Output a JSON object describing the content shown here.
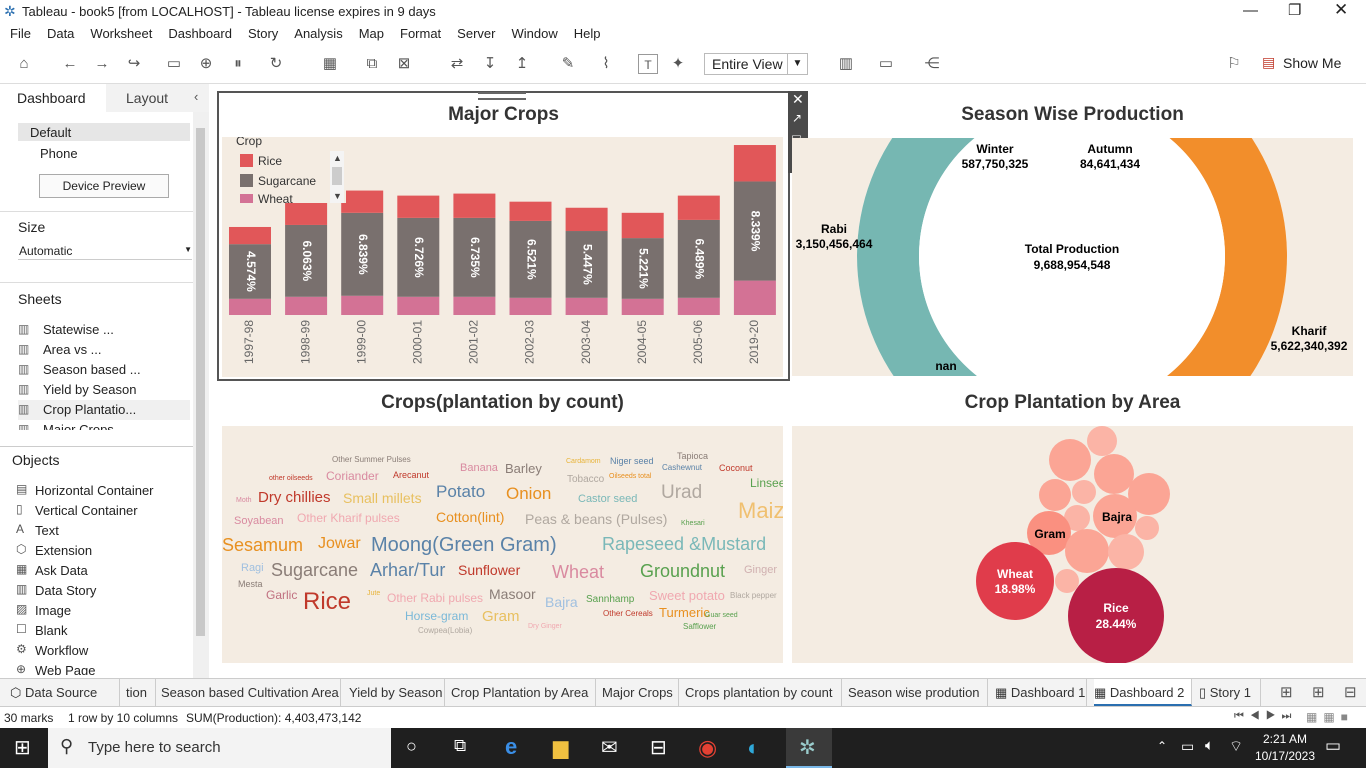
{
  "window": {
    "title": "Tableau - book5 [from LOCALHOST] - Tableau license expires in 9 days"
  },
  "menu": [
    "File",
    "Data",
    "Worksheet",
    "Dashboard",
    "Story",
    "Analysis",
    "Map",
    "Format",
    "Server",
    "Window",
    "Help"
  ],
  "toolbar": {
    "view_select": "Entire View",
    "show_me": "Show Me"
  },
  "left": {
    "tab_dashboard": "Dashboard",
    "tab_layout": "Layout",
    "device_default": "Default",
    "device_phone": "Phone",
    "device_preview": "Device Preview",
    "size_label": "Size",
    "size_value": "Automatic",
    "sheets_label": "Sheets",
    "sheets": [
      "Statewise ...",
      "Area vs ...",
      "Season based ...",
      "Yield by Season",
      "Crop Plantatio...",
      "Major Crops"
    ],
    "objects_label": "Objects",
    "objects": [
      "Horizontal Container",
      "Vertical Container",
      "Text",
      "Extension",
      "Ask Data",
      "Data Story",
      "Image",
      "Blank",
      "Workflow",
      "Web Page"
    ]
  },
  "major_crops": {
    "title": "Major Crops",
    "legend_title": "Crop",
    "legend": [
      "Rice",
      "Sugarcane",
      "Wheat"
    ]
  },
  "season": {
    "title": "Season Wise Production",
    "winter_label": "Winter",
    "winter_value": "587,750,325",
    "autumn_label": "Autumn",
    "autumn_value": "84,641,434",
    "rabi_label": "Rabi",
    "rabi_value": "3,150,456,464",
    "total_label": "Total Production",
    "total_value": "9,688,954,548",
    "kharif_label": "Kharif",
    "kharif_value": "5,622,340,392",
    "nan_label": "nan"
  },
  "wordcloud": {
    "title": "Crops(plantation by count)"
  },
  "bubble": {
    "title": "Crop Plantation by Area",
    "bajra": "Bajra",
    "gram": "Gram",
    "wheat": "Wheat",
    "wheat_pct": "18.98%",
    "rice": "Rice",
    "rice_pct": "28.44%"
  },
  "tabs": [
    "Data Source",
    "tion",
    "Season based Cultivation Area",
    "Yield by Season",
    "Crop Plantation by Area",
    "Major Crops",
    "Crops plantation by count",
    "Season wise prodution",
    "Dashboard 1",
    "Dashboard 2",
    "Story 1"
  ],
  "status": {
    "marks": "30 marks",
    "rows": "1 row by 10 columns",
    "sum": "SUM(Production): 4,403,473,142"
  },
  "taskbar": {
    "search": "Type here to search",
    "time": "2:21 AM",
    "date": "10/17/2023"
  },
  "chart_data": [
    {
      "type": "bar",
      "title": "Major Crops",
      "categories": [
        "1997-98",
        "1998-99",
        "1999-00",
        "2000-01",
        "2001-02",
        "2002-03",
        "2003-04",
        "2004-05",
        "2005-06",
        "2019-20"
      ],
      "bar_labels": [
        "4.574%",
        "6.063%",
        "6.839%",
        "6.726%",
        "6.735%",
        "6.521%",
        "5.447%",
        "5.221%",
        "6.489%",
        "8.339%"
      ],
      "series": [
        {
          "name": "Wheat",
          "values": [
            16,
            18,
            19,
            18,
            18,
            17,
            17,
            16,
            17,
            34
          ]
        },
        {
          "name": "Sugarcane",
          "values": [
            54,
            71,
            82,
            78,
            78,
            76,
            66,
            60,
            77,
            98
          ]
        },
        {
          "name": "Rice",
          "values": [
            17,
            22,
            22,
            22,
            24,
            19,
            23,
            25,
            24,
            36
          ]
        }
      ],
      "ylim": [
        0,
        170
      ],
      "legend": "top-left"
    },
    {
      "type": "pie",
      "title": "Season Wise Production",
      "categories": [
        "Rabi",
        "Kharif",
        "Winter",
        "Autumn"
      ],
      "values": [
        3150456464,
        5622340392,
        587750325,
        84641434
      ]
    },
    {
      "type": "scatter",
      "title": "Crop Plantation by Area",
      "labels": [
        "Rice",
        "Wheat",
        "Gram",
        "Bajra"
      ],
      "values": [
        28.44,
        18.98,
        null,
        null
      ]
    }
  ],
  "wordcloud_words": [
    [
      "Other Summer Pulses",
      8,
      "#8a7d77"
    ],
    [
      "Tapioca",
      9,
      "#8a7d77"
    ],
    [
      "Banana",
      11,
      "#d98aa0"
    ],
    [
      "Barley",
      13,
      "#8a7d77"
    ],
    [
      "Cardamom",
      7,
      "#e8b43a"
    ],
    [
      "Niger seed",
      9,
      "#5a82a8"
    ],
    [
      "Cashewnut",
      8,
      "#5a82a8"
    ],
    [
      "Coconut",
      9,
      "#c0392b"
    ],
    [
      "other oilseeds",
      7,
      "#c0392b"
    ],
    [
      "Arecanut",
      9,
      "#c0392b"
    ],
    [
      "Tobacco",
      10,
      "#b0a8a0"
    ],
    [
      "Oilseeds total",
      7,
      "#e89020"
    ],
    [
      "Linseed",
      12,
      "#59a14f"
    ],
    [
      "Moth",
      7,
      "#d98aa0"
    ],
    [
      "Dry chillies",
      15,
      "#c0392b"
    ],
    [
      "Coriander",
      12,
      "#d98aa0"
    ],
    [
      "Potato",
      17,
      "#5a82a8"
    ],
    [
      "Onion",
      17,
      "#e89020"
    ],
    [
      "Urad",
      19,
      "#b0a8a0"
    ],
    [
      "Small millets",
      14,
      "#e8c060"
    ],
    [
      "Castor seed",
      11,
      "#7ab8b8"
    ],
    [
      "Soyabean",
      11,
      "#d98aa0"
    ],
    [
      "Other Kharif pulses",
      12,
      "#f0a8b0"
    ],
    [
      "Cotton(lint)",
      14,
      "#e89020"
    ],
    [
      "Peas & beans (Pulses)",
      14,
      "#b0a8a0"
    ],
    [
      "Khesari",
      7,
      "#59a14f"
    ],
    [
      "Maize",
      22,
      "#f0c070"
    ],
    [
      "Sesamum",
      18,
      "#e89020"
    ],
    [
      "Jowar",
      16,
      "#e89020"
    ],
    [
      "Moong(Green Gram)",
      20,
      "#5a82a8"
    ],
    [
      "Rapeseed &Mustard",
      18,
      "#7ab8b8"
    ],
    [
      "Ragi",
      11,
      "#a0c0e0"
    ],
    [
      "Sugarcane",
      18,
      "#8a7d77"
    ],
    [
      "Arhar/Tur",
      18,
      "#5a82a8"
    ],
    [
      "Sunflower",
      14,
      "#c0392b"
    ],
    [
      "Wheat",
      18,
      "#d98aa0"
    ],
    [
      "Groundnut",
      18,
      "#59a14f"
    ],
    [
      "Ginger",
      11,
      "#d0b0b0"
    ],
    [
      "Mesta",
      9,
      "#8a7d77"
    ],
    [
      "Garlic",
      12,
      "#c07080"
    ],
    [
      "Rice",
      24,
      "#c0392b"
    ],
    [
      "Jute",
      7,
      "#e8b43a"
    ],
    [
      "Other Rabi pulses",
      12,
      "#f0a8b0"
    ],
    [
      "Masoor",
      14,
      "#8a7d77"
    ],
    [
      "Bajra",
      14,
      "#a0c0e0"
    ],
    [
      "Sannhamp",
      10,
      "#59a14f"
    ],
    [
      "Sweet potato",
      13,
      "#f0a8b0"
    ],
    [
      "Black pepper",
      8,
      "#b0a8a0"
    ],
    [
      "Horse-gram",
      12,
      "#7ab8d8"
    ],
    [
      "Gram",
      15,
      "#e8c060"
    ],
    [
      "Dry Ginger",
      7,
      "#f0a8b0"
    ],
    [
      "Other Cereals",
      8,
      "#c0392b"
    ],
    [
      "Turmeric",
      13,
      "#e89020"
    ],
    [
      "Guar seed",
      7,
      "#59a14f"
    ],
    [
      "Cowpea(Lobia)",
      8,
      "#b0a8a0"
    ],
    [
      "Safflower",
      8,
      "#59a14f"
    ]
  ]
}
